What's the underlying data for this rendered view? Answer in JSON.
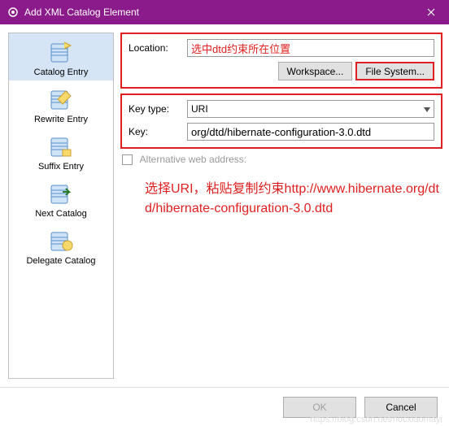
{
  "titlebar": {
    "title": "Add XML Catalog Element"
  },
  "sidebar": {
    "items": [
      {
        "label": "Catalog Entry"
      },
      {
        "label": "Rewrite Entry"
      },
      {
        "label": "Suffix Entry"
      },
      {
        "label": "Next Catalog"
      },
      {
        "label": "Delegate Catalog"
      }
    ]
  },
  "form": {
    "location_label": "Location:",
    "location_value": "选中dtd约束所在位置",
    "workspace_btn": "Workspace...",
    "filesystem_btn": "File System...",
    "keytype_label": "Key type:",
    "keytype_value": "URI",
    "key_label": "Key:",
    "key_value": "org/dtd/hibernate-configuration-3.0.dtd",
    "alt_label": "Alternative web address:"
  },
  "annotation": "选择URI，粘贴复制约束http://www.hibernate.org/dtd/hibernate-configuration-3.0.dtd",
  "footer": {
    "ok": "OK",
    "cancel": "Cancel"
  },
  "watermark": "https://blog.csdn.net/nucxiaomayi"
}
